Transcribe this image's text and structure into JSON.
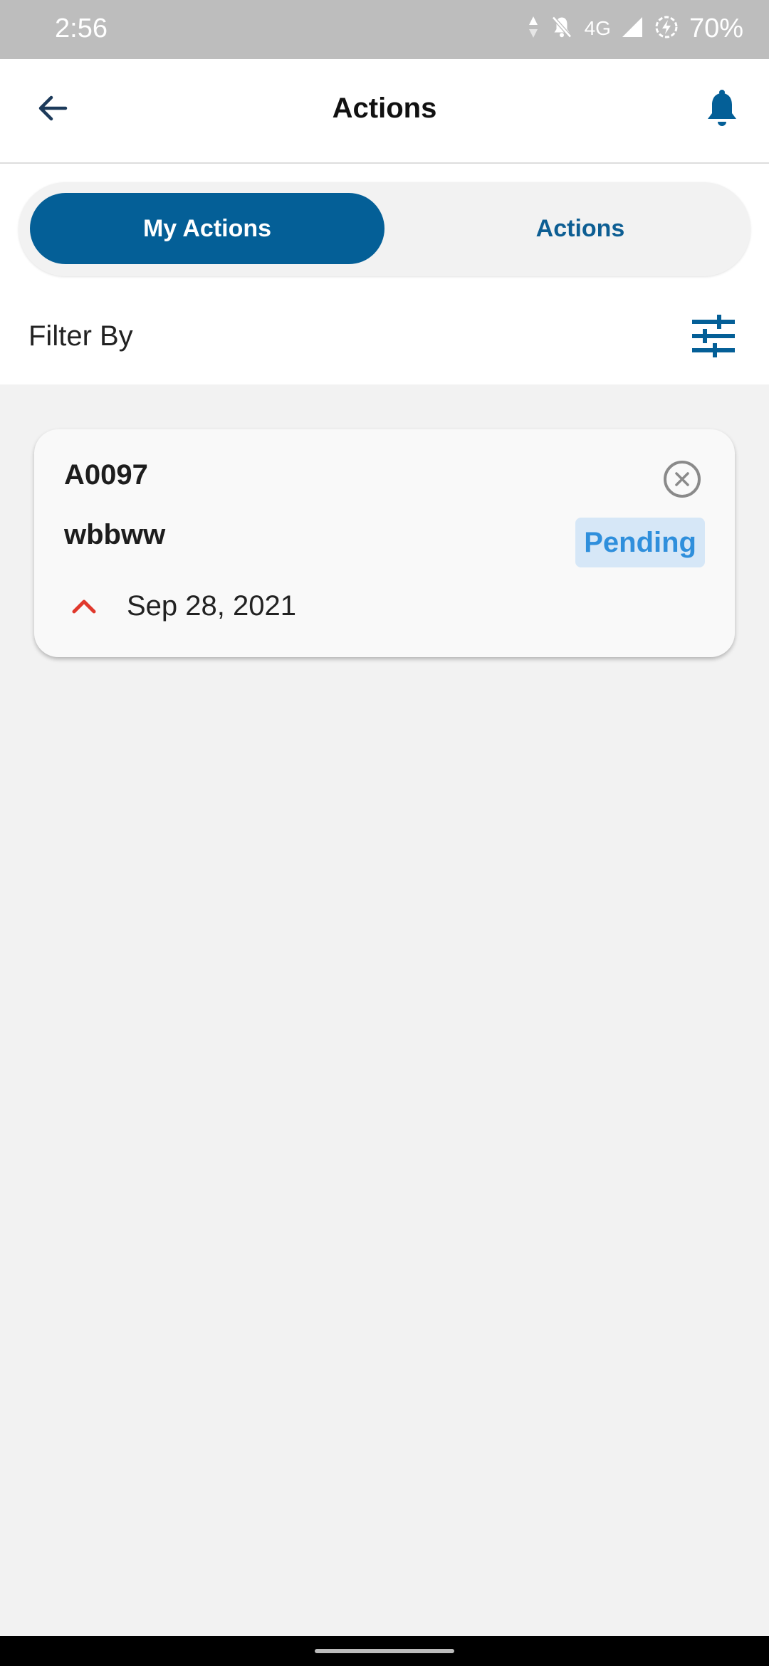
{
  "status_bar": {
    "time": "2:56",
    "network": "4G",
    "battery": "70%",
    "icons": [
      "data-arrows-icon",
      "do-not-disturb-bell-icon",
      "signal-icon",
      "battery-saver-icon"
    ]
  },
  "header": {
    "title": "Actions",
    "back_icon": "arrow-left-icon",
    "bell_icon": "bell-icon"
  },
  "tabs": [
    {
      "label": "My Actions",
      "active": true
    },
    {
      "label": "Actions",
      "active": false
    }
  ],
  "filter": {
    "label": "Filter By",
    "icon": "sliders-icon"
  },
  "actions": [
    {
      "id": "A0097",
      "name": "wbbww",
      "status": "Pending",
      "date": "Sep 28, 2021",
      "priority_icon": "chevron-up-icon"
    }
  ],
  "colors": {
    "primary": "#045f97",
    "status_bar": "#bdbdbd",
    "background": "#f2f2f2",
    "pending_text": "#2f8fdc",
    "pending_bg": "#d6e7f7",
    "priority": "#e0382c"
  }
}
